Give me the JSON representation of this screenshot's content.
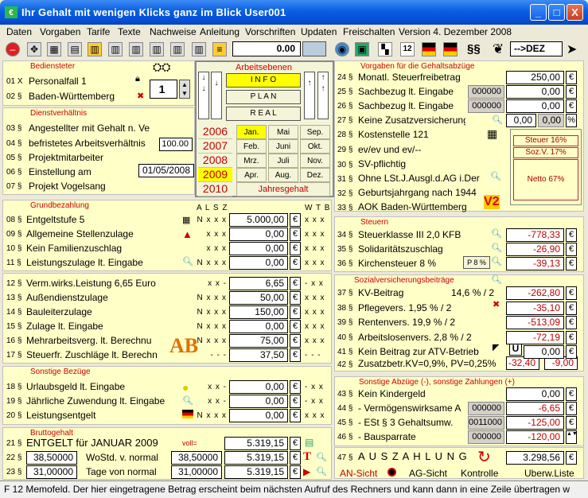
{
  "window": {
    "title": "Ihr Gehalt mit wenigen Klicks ganz im Blick     User001",
    "min": "_",
    "max": "□",
    "close": "X"
  },
  "menu": [
    "Daten",
    "Vorgaben",
    "Tarife",
    "Texte",
    "Nachweise",
    "Anleitung",
    "Vorschriften",
    "Updaten",
    "Freischalten",
    "Version 4. Dezember 2008"
  ],
  "toolbar": {
    "zoom_value": "0.00",
    "dez_label": "-->DEZ"
  },
  "bediensteter": {
    "title": "Bediensteter",
    "row1": "Personalfall 1",
    "row1_num": "01 X",
    "row2": "Baden-Württemberg",
    "row2_num": "02 §",
    "spinner": "1"
  },
  "arbeitsebenen": {
    "title": "Arbeitsebenen",
    "info": "I N F O",
    "plan": "P L A N",
    "real": "R E A L"
  },
  "years": [
    "2006",
    "2007",
    "2008",
    "2009",
    "2010"
  ],
  "months": [
    "Jan.",
    "Mai",
    "Sep.",
    "Feb.",
    "Juni",
    "Okt.",
    "Mrz.",
    "Juli",
    "Nov.",
    "Apr.",
    "Aug.",
    "Dez."
  ],
  "jahresgehalt": "Jahresgehalt",
  "dienst": {
    "title": "Dienstverhältnis",
    "r3": "Angestellter mit Gehalt n. Ve",
    "r3n": "03 §",
    "r4": "befristetes Arbeitsverhältnis",
    "r4n": "04 §",
    "r4v": "100.00",
    "r5": "Projektmitarbeiter",
    "r5n": "05 §",
    "r6": "Einstellung am",
    "r6n": "06 §",
    "r6v": "01/05/2008",
    "r7": "Projekt Vogelsang",
    "r7n": "07 §"
  },
  "grund": {
    "title": "Grundbezahlung",
    "hdr1": "A L S Z",
    "hdr2": "W T B",
    "rows": [
      {
        "n": "08 §",
        "label": "Entgeltstufe 5",
        "f1": "N x x x",
        "val": "5.000,00",
        "f2": "x x x"
      },
      {
        "n": "09 §",
        "label": "Allgemeine Stellenzulage",
        "f1": "x x x",
        "val": "0,00",
        "f2": "x x x"
      },
      {
        "n": "10 §",
        "label": "Kein Familienzuschlag",
        "f1": "x x x",
        "val": "0,00",
        "f2": "x x x"
      },
      {
        "n": "11 §",
        "label": "Leistungszulage lt. Eingabe",
        "f1": "N x x x",
        "val": "0,00",
        "f2": "x x x"
      }
    ]
  },
  "zulagen": {
    "rows": [
      {
        "n": "12 §",
        "label": "Verm.wirks.Leistung   6,65 Euro",
        "f1": "x x -",
        "val": "6,65",
        "f2": "- x x"
      },
      {
        "n": "13 §",
        "label": "Außendienstzulage",
        "f1": "N x x x",
        "val": "50,00",
        "f2": "x x x"
      },
      {
        "n": "14 §",
        "label": "Bauleiterzulage",
        "f1": "N x x x",
        "val": "150,00",
        "f2": "x x x"
      },
      {
        "n": "15 §",
        "label": "Zulage lt. Eingabe",
        "f1": "N x x x",
        "val": "0,00",
        "f2": "x x x"
      },
      {
        "n": "16 §",
        "label": "Mehrarbeitsverg. lt. Berechnu",
        "f1": "N x x x",
        "val": "75,00",
        "f2": "x x x"
      },
      {
        "n": "17 §",
        "label": "Steuerfr. Zuschläge lt. Berechn",
        "f1": "- - -",
        "val": "37,50",
        "f2": "- - -"
      }
    ]
  },
  "sonstige": {
    "title": "Sonstige Bezüge",
    "rows": [
      {
        "n": "18 §",
        "label": "Urlaubsgeld lt. Eingabe",
        "f1": "x x -",
        "val": "0,00",
        "f2": "- x x"
      },
      {
        "n": "19 §",
        "label": "Jährliche Zuwendung lt. Eingabe",
        "f1": "x x -",
        "val": "0,00",
        "f2": "- x x"
      },
      {
        "n": "20 §",
        "label": "Leistungsentgelt",
        "f1": "N x x x",
        "val": "0,00",
        "f2": "x x x"
      }
    ]
  },
  "brutto": {
    "title": "Bruttogehalt",
    "r21n": "21 §",
    "r21": "ENTGELT für JANUAR  2009",
    "voll": "voll=",
    "r21v": "5.319,15",
    "r22n": "22 §",
    "r22a": "38,50000",
    "r22": "WoStd. v. normal",
    "r22b": "38,50000",
    "r22v": "5.319,15",
    "r23n": "23 §",
    "r23a": "31,00000",
    "r23": "Tage von normal",
    "r23b": "31,00000",
    "r23v": "5.319,15"
  },
  "vorgaben": {
    "title": "Vorgaben für die Gehaltsabzüge",
    "rows": [
      {
        "n": "24 §",
        "label": "Monatl. Steuerfreibetrag",
        "code": "",
        "val": "250,00",
        "unit": "€"
      },
      {
        "n": "25 §",
        "label": "Sachbezug lt. Eingabe",
        "code": "000000",
        "val": "0,00",
        "unit": "€"
      },
      {
        "n": "26 §",
        "label": "Sachbezug lt. Eingabe",
        "code": "000000",
        "val": "0,00",
        "unit": "€"
      },
      {
        "n": "27 §",
        "label": "Keine Zusatzversicherung",
        "code": "0,00",
        "val": "0,00",
        "unit": "%"
      }
    ],
    "r28n": "28 §",
    "r28": "Kostenstelle 121",
    "r29n": "29 §",
    "r29": "ev/ev und ev/--",
    "r30n": "30 §",
    "r30": "SV-pflichtig",
    "r31n": "31 §",
    "r31": "Ohne LSt.J.Ausgl.d.AG i.Der",
    "r32n": "32 §",
    "r32": "Geburtsjahrgang nach 1944",
    "r33n": "33 §",
    "r33": "AOK Baden-Württemberg",
    "steuer_pct": "Steuer 16%",
    "sozv_pct": "Soz.V. 17%",
    "netto_pct": "Netto  67%"
  },
  "steuern": {
    "title": "Steuern",
    "rows": [
      {
        "n": "34 §",
        "label": "Steuerklasse III   2,0 KFB",
        "val": "-778,33"
      },
      {
        "n": "35 §",
        "label": "Solidaritätszuschlag",
        "val": "-26,90"
      },
      {
        "n": "36 §",
        "label": "Kirchensteuer 8 %",
        "val": "-39,13"
      }
    ],
    "p8": "P 8 %"
  },
  "sozial": {
    "title": "Sozialversicherungsbeiträge",
    "rows": [
      {
        "n": "37 §",
        "label": "KV-Beitrag",
        "extra": "14,6 % / 2",
        "val": "-262,80"
      },
      {
        "n": "38 §",
        "label": "Pflegevers. 1,95 % / 2",
        "extra": "",
        "val": "-35,10"
      },
      {
        "n": "39 §",
        "label": "Rentenvers. 19,9 % / 2",
        "extra": "",
        "val": "-513,09"
      },
      {
        "n": "40 §",
        "label": "Arbeitslosenvers. 2,8 % / 2",
        "extra": "",
        "val": "-72,19"
      },
      {
        "n": "41 §",
        "label": "Kein Beitrag zur ATV-Betrieb",
        "extra": "",
        "val": "0,00"
      }
    ],
    "u": "U",
    "r42n": "42 §",
    "r42": "Zusatzbetr.KV=0,9%, PV=0,25%",
    "r42a": "-32,40",
    "r42b": "-9,00"
  },
  "abzuege": {
    "title": "Sonstige Abzüge (-), sonstige Zahlungen (+)",
    "rows": [
      {
        "n": "43 §",
        "label": "Kein Kindergeld",
        "code": "",
        "val": "0,00",
        "neg": false
      },
      {
        "n": "44 §",
        "label": "- Vermögenswirksame A",
        "code": "000000",
        "val": "-6,65",
        "neg": true
      },
      {
        "n": "45 §",
        "label": "- ESt § 3 Gehaltsumw.",
        "code": "0011000",
        "val": "-125,00",
        "neg": true
      },
      {
        "n": "46 §",
        "label": "- Bausparrate",
        "code": "000000",
        "val": "-120,00",
        "neg": true
      }
    ]
  },
  "auszahlung": {
    "n": "47 §",
    "label": "A U S Z A H L U N G",
    "val": "3.298,56"
  },
  "bottom": {
    "an": "AN-Sicht",
    "ag": "AG-Sicht",
    "kontrolle": "Kontrolle",
    "liste": "Uberw.Liste"
  },
  "status": "F 12 Memofeld. Der hier eingetragene Betrag erscheint beim nächsten Aufruf des Rechners und kann dann in eine Zeile übertragen w",
  "euro": "€"
}
